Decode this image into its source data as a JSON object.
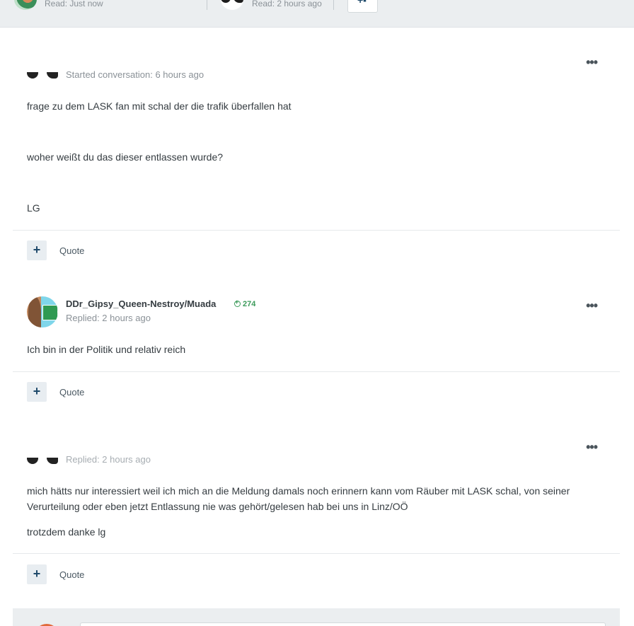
{
  "topbar": {
    "participant1_read": "Read: Just now",
    "participant2_read": "Read: 2 hours ago",
    "add_icon": "plus-user-icon"
  },
  "posts": [
    {
      "meta": "Started conversation: 6 hours ago",
      "paragraphs": [
        "frage zu dem LASK fan mit schal der die trafik überfallen hat",
        "woher weißt du das dieser entlassen wurde?",
        "LG"
      ],
      "quote_label": "Quote",
      "plus_label": "+"
    },
    {
      "author": "DDr_Gipsy_Queen-Nestroy/Muada",
      "reputation": "274",
      "meta": "Replied: 2 hours ago",
      "paragraphs": [
        "Ich bin in der Politik und relativ reich"
      ],
      "quote_label": "Quote",
      "plus_label": "+"
    },
    {
      "meta": "Replied: 2 hours ago",
      "paragraphs": [
        "mich hätts nur interessiert weil ich mich an die Meldung damals noch erinnern kann vom Räuber mit LASK schal, von seiner Verurteilung oder eben jetzt Entlassung nie was gehört/gelesen hab bei uns in Linz/OÖ",
        "trotzdem danke lg"
      ],
      "quote_label": "Quote",
      "plus_label": "+"
    }
  ],
  "more_icon": "•••",
  "colors": {
    "accent": "#1f4a6b",
    "reputation": "#3b9a5a",
    "muted": "#8a9197",
    "topbar_bg": "#ebeef0"
  }
}
